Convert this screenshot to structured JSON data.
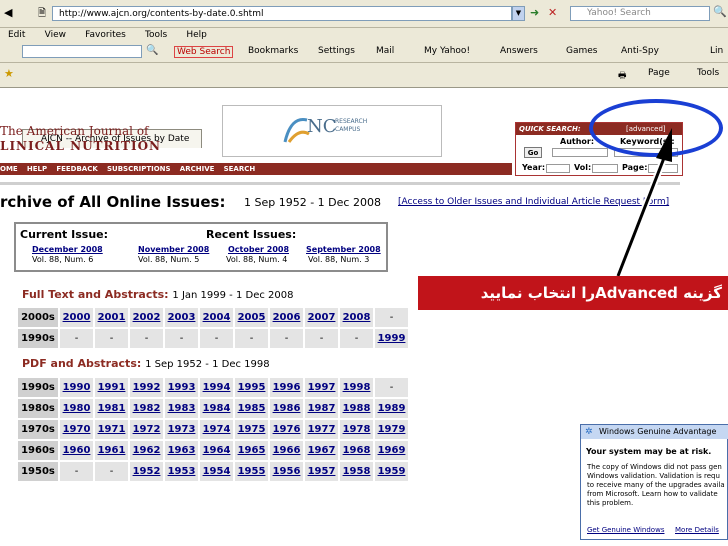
{
  "browser": {
    "address": "http://www.ajcn.org/contents-by-date.0.shtml",
    "search_placeholder": "Yahoo! Search",
    "menu": [
      "Edit",
      "View",
      "Favorites",
      "Tools",
      "Help"
    ],
    "toolbar": {
      "web_search": "Web Search",
      "bookmarks": "Bookmarks",
      "settings": "Settings",
      "mail": "Mail",
      "my_yahoo": "My Yahoo!",
      "answers": "Answers",
      "games": "Games",
      "antispy": "Anti-Spy",
      "links": "Lin"
    },
    "tab_title": "AJCN -- Archive of Issues by Date",
    "page_menu": "Page",
    "tools_menu": "Tools"
  },
  "header": {
    "journal_line1": "The American Journal of",
    "journal_line2": "LINICAL NUTRITION",
    "banner_text": "NC",
    "banner_sub1": "RESEARCH",
    "banner_sub2": "CAMPUS",
    "quick_search": "QUICK SEARCH:",
    "advanced": "[advanced]",
    "author_label": "Author:",
    "keyword_label": "Keyword(s):",
    "go": "Go",
    "year_label": "Year:",
    "vol_label": "Vol:",
    "page_label": "Page:"
  },
  "nav": [
    "OME",
    "HELP",
    "FEEDBACK",
    "SUBSCRIPTIONS",
    "ARCHIVE",
    "SEARCH"
  ],
  "archive": {
    "title": "rchive of All Online Issues:",
    "range": "1 Sep 1952 - 1 Dec 2008",
    "older_link": "[Access to Older Issues and Individual Article Request Form]"
  },
  "issues": {
    "current_label": "Current Issue:",
    "recent_label": "Recent Issues:",
    "current": {
      "month": "December 2008",
      "vol": "Vol. 88, Num. 6"
    },
    "recent": [
      {
        "month": "November 2008",
        "vol": "Vol. 88, Num. 5"
      },
      {
        "month": "October 2008",
        "vol": "Vol. 88, Num. 4"
      },
      {
        "month": "September 2008",
        "vol": "Vol. 88, Num. 3"
      }
    ]
  },
  "fulltext": {
    "title": "Full Text and Abstracts:",
    "range": "1 Jan 1999 - 1 Dec 2008",
    "rows": [
      {
        "decade": "2000s",
        "years": [
          "2000",
          "2001",
          "2002",
          "2003",
          "2004",
          "2005",
          "2006",
          "2007",
          "2008",
          "-"
        ]
      },
      {
        "decade": "1990s",
        "years": [
          "-",
          "-",
          "-",
          "-",
          "-",
          "-",
          "-",
          "-",
          "-",
          "1999"
        ]
      }
    ]
  },
  "pdf": {
    "title": "PDF and Abstracts:",
    "range": "1 Sep 1952 - 1 Dec 1998",
    "rows": [
      {
        "decade": "1990s",
        "years": [
          "1990",
          "1991",
          "1992",
          "1993",
          "1994",
          "1995",
          "1996",
          "1997",
          "1998",
          "-"
        ]
      },
      {
        "decade": "1980s",
        "years": [
          "1980",
          "1981",
          "1982",
          "1983",
          "1984",
          "1985",
          "1986",
          "1987",
          "1988",
          "1989"
        ]
      },
      {
        "decade": "1970s",
        "years": [
          "1970",
          "1971",
          "1972",
          "1973",
          "1974",
          "1975",
          "1976",
          "1977",
          "1978",
          "1979"
        ]
      },
      {
        "decade": "1960s",
        "years": [
          "1960",
          "1961",
          "1962",
          "1963",
          "1964",
          "1965",
          "1966",
          "1967",
          "1968",
          "1969"
        ]
      },
      {
        "decade": "1950s",
        "years": [
          "-",
          "-",
          "1952",
          "1953",
          "1954",
          "1955",
          "1956",
          "1957",
          "1958",
          "1959"
        ]
      }
    ]
  },
  "annotation": {
    "text": "گزینه Advancedرا انتخاب نمایید",
    "ellipse_color": "#1a3fd4",
    "label_color": "#c1141a"
  },
  "wga": {
    "title": "Windows Genuine Advantage",
    "headline": "Your system may be at risk.",
    "body": "The copy of Windows did not pass gen\nWindows validation. Validation is requ\nto receive many of the upgrades availa\nfrom Microsoft. Learn how to validate\nthis problem.",
    "link1": "Get Genuine Windows",
    "link2": "More Details"
  },
  "colors": {
    "brand": "#8c2b22",
    "link": "#000080"
  }
}
